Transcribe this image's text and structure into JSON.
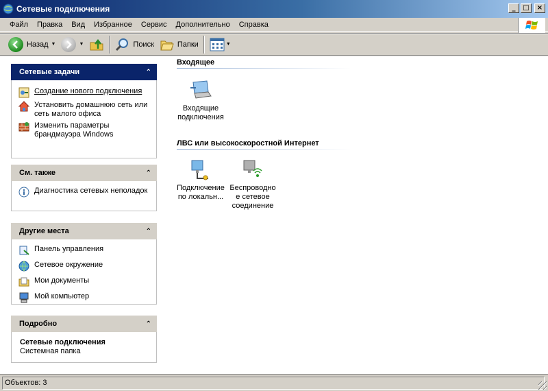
{
  "window": {
    "title": "Сетевые подключения"
  },
  "menu": [
    "Файл",
    "Правка",
    "Вид",
    "Избранное",
    "Сервис",
    "Дополнительно",
    "Справка"
  ],
  "toolbar": {
    "back_label": "Назад",
    "search_label": "Поиск",
    "folders_label": "Папки"
  },
  "panels": {
    "network_tasks": {
      "title": "Сетевые задачи",
      "items": [
        {
          "label": "Создание нового подключения",
          "icon": "new-connection-icon"
        },
        {
          "label": "Установить домашнюю сеть или сеть малого офиса",
          "icon": "home-network-icon"
        },
        {
          "label": "Изменить параметры брандмауэра Windows",
          "icon": "firewall-icon"
        }
      ]
    },
    "see_also": {
      "title": "См. также",
      "items": [
        {
          "label": "Диагностика сетевых неполадок",
          "icon": "info-icon"
        }
      ]
    },
    "other_places": {
      "title": "Другие места",
      "items": [
        {
          "label": "Панель управления",
          "icon": "control-panel-icon"
        },
        {
          "label": "Сетевое окружение",
          "icon": "network-places-icon"
        },
        {
          "label": "Мои документы",
          "icon": "my-documents-icon"
        },
        {
          "label": "Мой компьютер",
          "icon": "my-computer-icon"
        }
      ]
    },
    "details": {
      "title": "Подробно",
      "name": "Сетевые подключения",
      "type": "Системная папка"
    }
  },
  "groups": {
    "incoming": {
      "title": "Входящее",
      "items": [
        {
          "label_line1": "Входящие",
          "label_line2": "подключения"
        }
      ]
    },
    "lan": {
      "title": "ЛВС или высокоскоростной Интернет",
      "items": [
        {
          "label_line1": "Подключение",
          "label_line2": "по локальн..."
        },
        {
          "label_line1": "Беспроводно",
          "label_line2": "е сетевое",
          "label_line3": "соединение"
        }
      ]
    }
  },
  "status": {
    "text": "Объектов: 3"
  }
}
